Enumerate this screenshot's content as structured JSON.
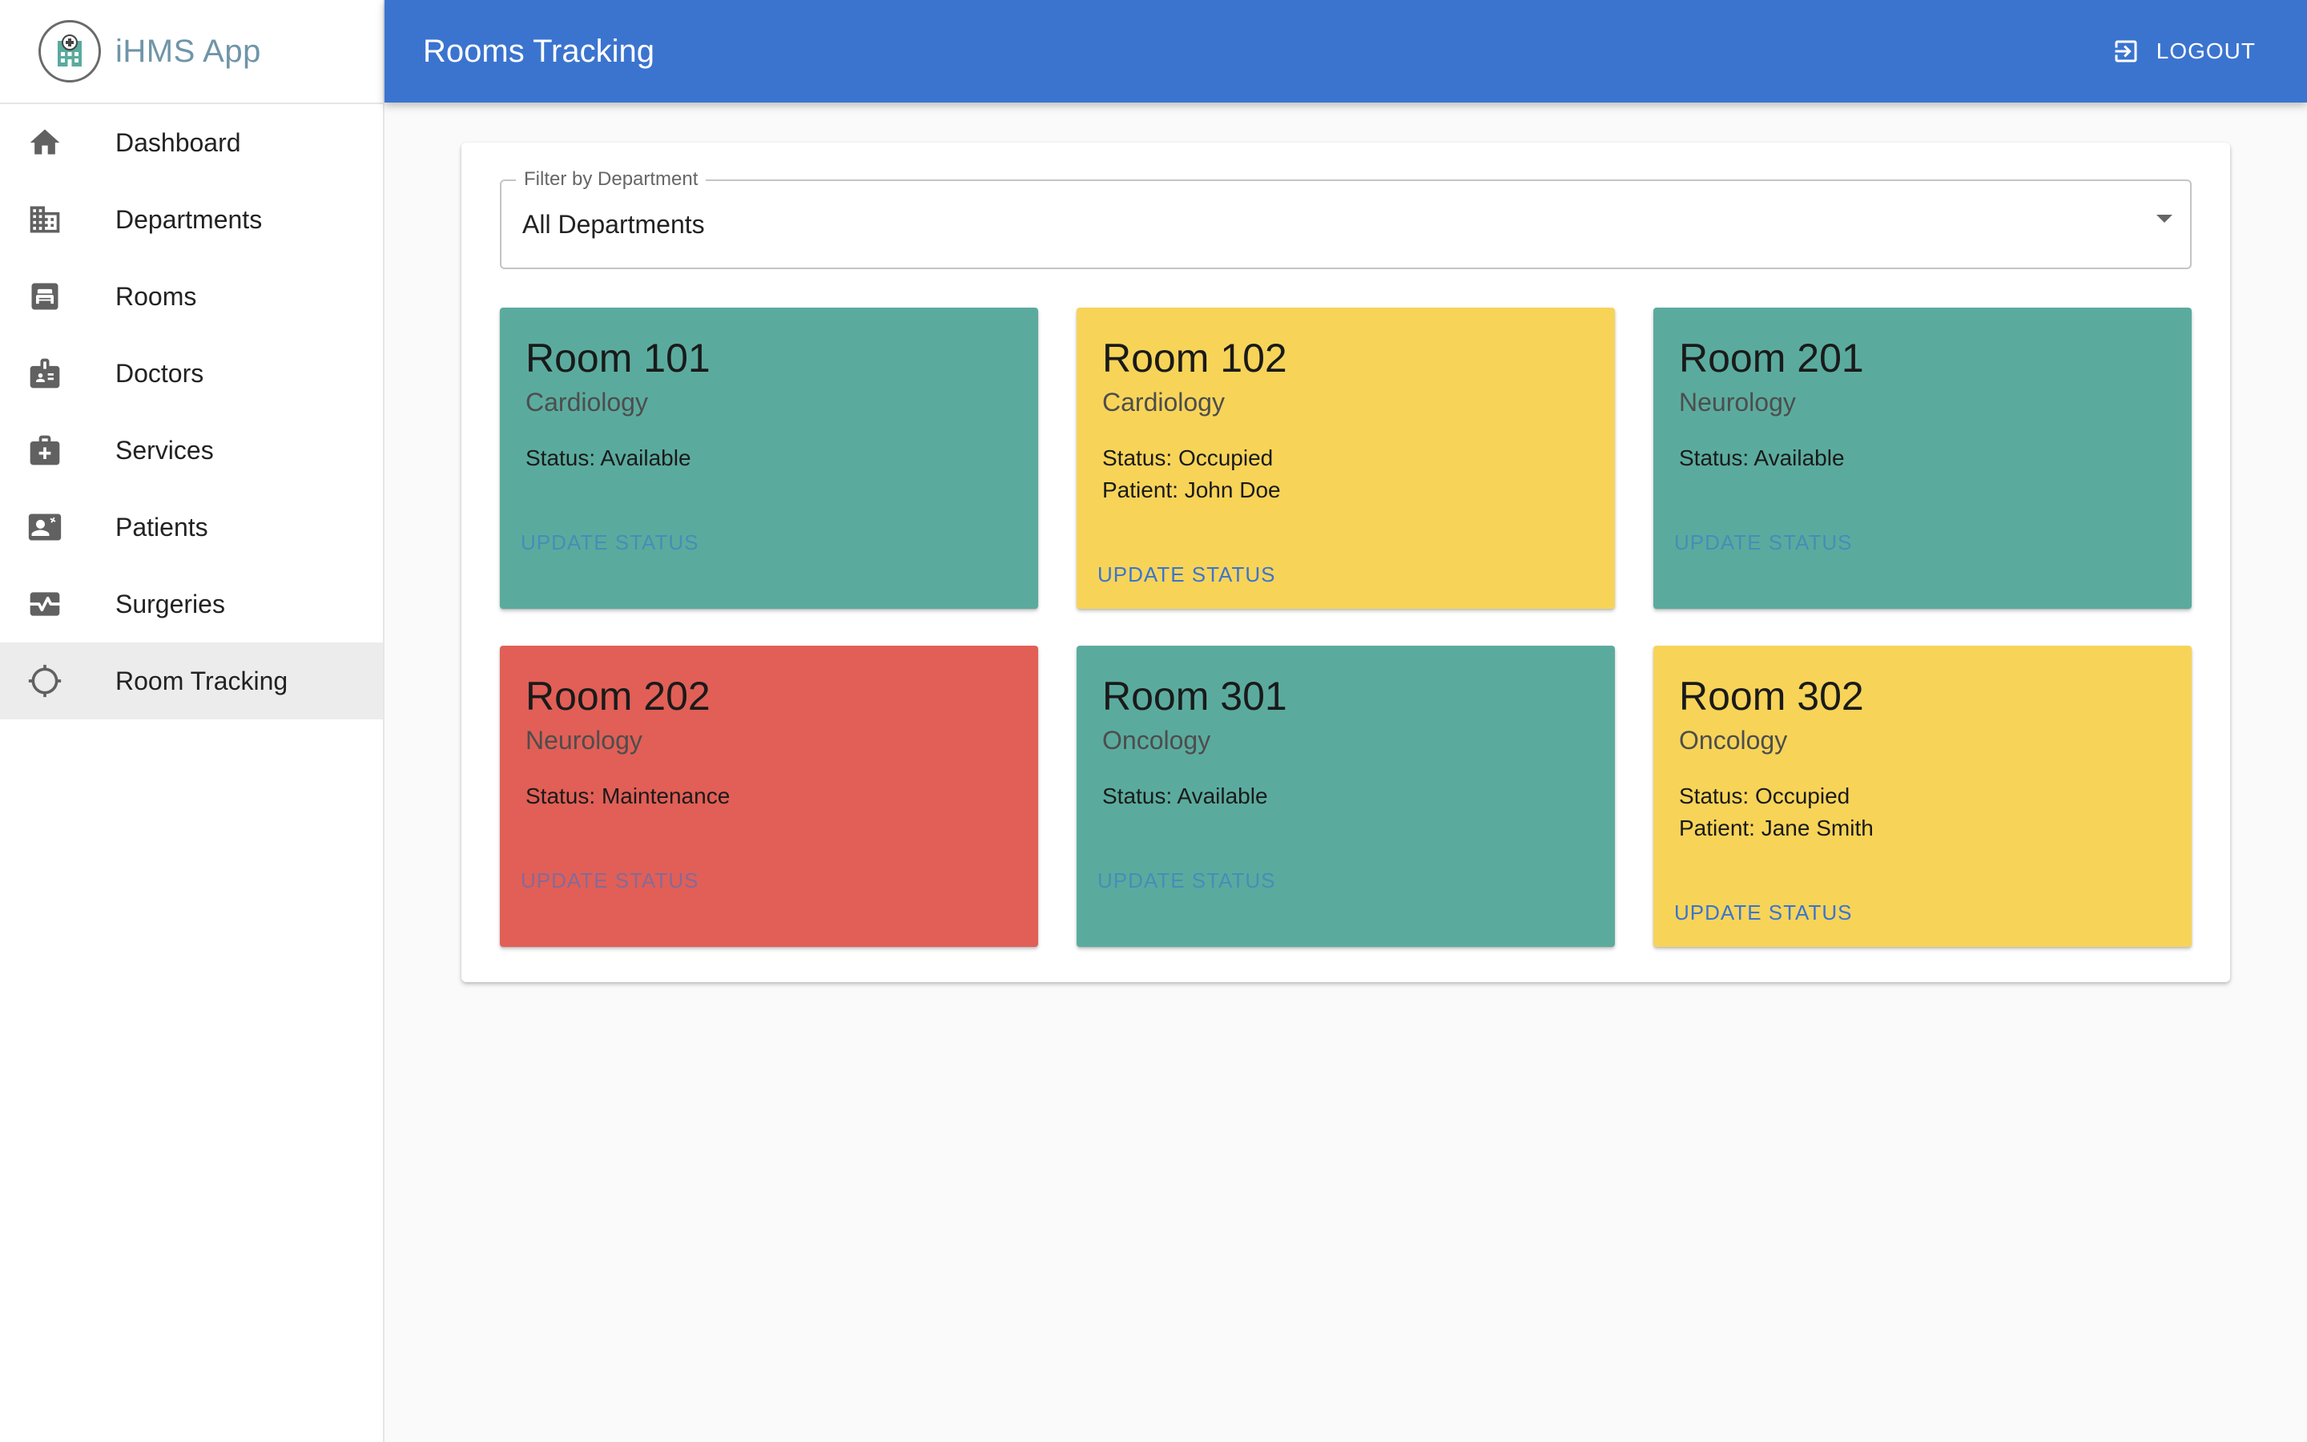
{
  "brand": {
    "name": "iHMS App"
  },
  "sidebar": {
    "items": [
      {
        "label": "Dashboard",
        "icon": "home-icon"
      },
      {
        "label": "Departments",
        "icon": "building-icon"
      },
      {
        "label": "Rooms",
        "icon": "bed-icon"
      },
      {
        "label": "Doctors",
        "icon": "badge-icon"
      },
      {
        "label": "Services",
        "icon": "medical-bag-icon"
      },
      {
        "label": "Patients",
        "icon": "contact-card-icon"
      },
      {
        "label": "Surgeries",
        "icon": "monitor-heart-icon"
      },
      {
        "label": "Room Tracking",
        "icon": "crosshair-icon",
        "active": true
      }
    ]
  },
  "header": {
    "title": "Rooms Tracking",
    "logout_label": "LOGOUT"
  },
  "filter": {
    "label": "Filter by Department",
    "value": "All Departments"
  },
  "colors": {
    "available": "#5aab9e",
    "occupied": "#f7d458",
    "maintenance": "#e15f56",
    "accent": "#3b74cf"
  },
  "rooms": [
    {
      "name": "Room 101",
      "department": "Cardiology",
      "status": "Status: Available",
      "patient": "",
      "action": "UPDATE STATUS"
    },
    {
      "name": "Room 102",
      "department": "Cardiology",
      "status": "Status: Occupied",
      "patient": "Patient: John Doe",
      "action": "UPDATE STATUS"
    },
    {
      "name": "Room 201",
      "department": "Neurology",
      "status": "Status: Available",
      "patient": "",
      "action": "UPDATE STATUS"
    },
    {
      "name": "Room 202",
      "department": "Neurology",
      "status": "Status: Maintenance",
      "patient": "",
      "action": "UPDATE STATUS"
    },
    {
      "name": "Room 301",
      "department": "Oncology",
      "status": "Status: Available",
      "patient": "",
      "action": "UPDATE STATUS"
    },
    {
      "name": "Room 302",
      "department": "Oncology",
      "status": "Status: Occupied",
      "patient": "Patient: Jane Smith",
      "action": "UPDATE STATUS"
    }
  ]
}
